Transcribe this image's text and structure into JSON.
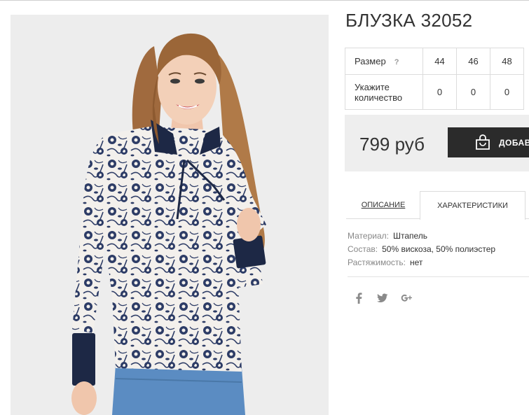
{
  "product": {
    "title": "БЛУЗКА 32052",
    "price": "799 руб",
    "add_button_label": "ДОБАВИТЬ"
  },
  "size_table": {
    "size_label": "Размер",
    "help_mark": "?",
    "sizes": [
      "44",
      "46",
      "48"
    ],
    "quantity_label_line1": "Укажите",
    "quantity_label_line2": "количество",
    "quantities": [
      "0",
      "0",
      "0"
    ]
  },
  "tabs": [
    {
      "label": "ОПИСАНИЕ",
      "active": false
    },
    {
      "label": "ХАРАКТЕРИСТИКИ",
      "active": true
    }
  ],
  "characteristics": [
    {
      "key": "Материал:",
      "value": "Штапель"
    },
    {
      "key": "Состав:",
      "value": "50% вискоза, 50% полиэстер"
    },
    {
      "key": "Растяжимость:",
      "value": "нет"
    }
  ],
  "social": [
    {
      "name": "facebook-icon",
      "glyph": "f"
    },
    {
      "name": "twitter-icon",
      "glyph": "twitter"
    },
    {
      "name": "google-plus-icon",
      "glyph": "g+"
    }
  ],
  "colors": {
    "button_bg": "#2b2b2b",
    "price_box_bg": "#eeeeee",
    "blouse_print": "#2d3c66",
    "blouse_base": "#f3f0ec",
    "collar": "#1d2845"
  }
}
